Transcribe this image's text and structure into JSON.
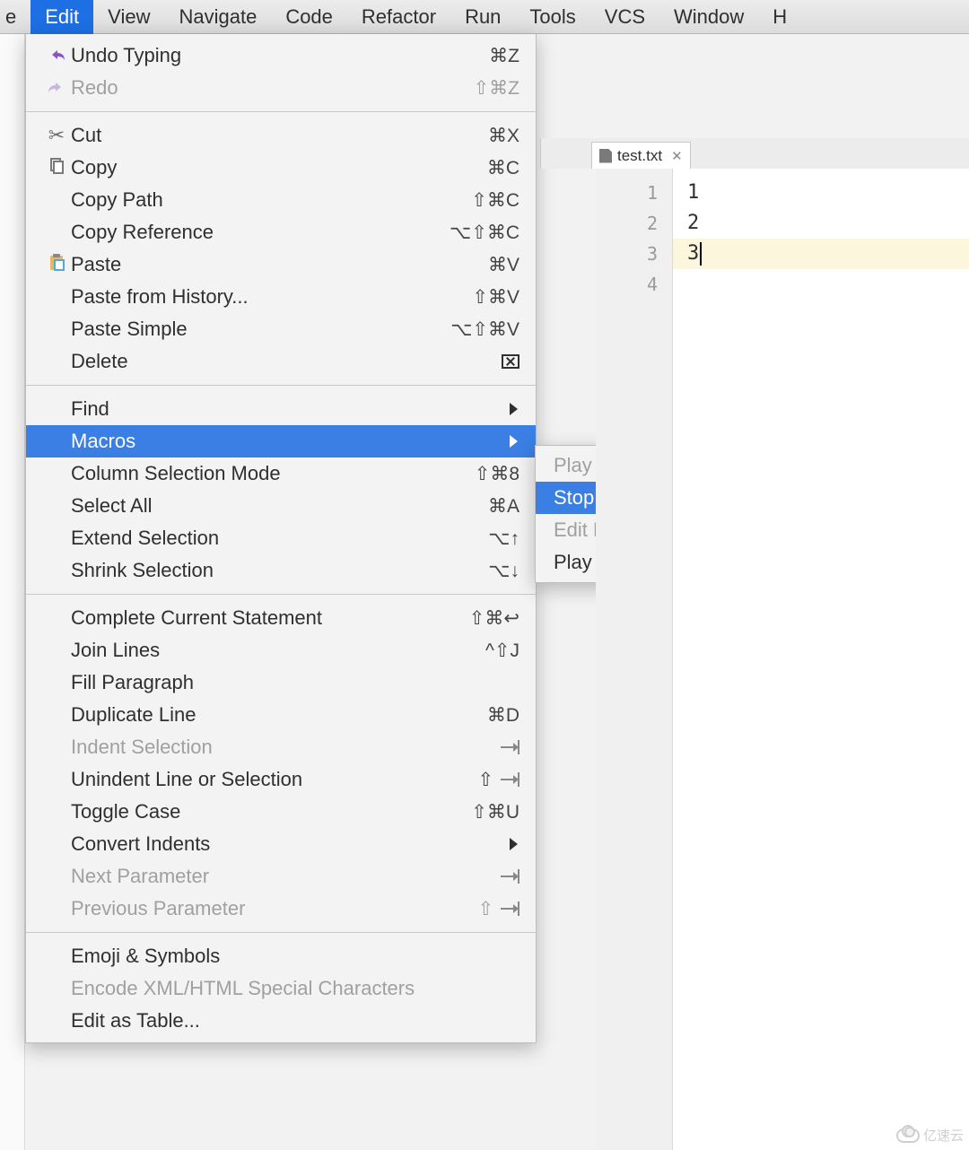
{
  "menubar": {
    "items": [
      "e",
      "Edit",
      "View",
      "Navigate",
      "Code",
      "Refactor",
      "Run",
      "Tools",
      "VCS",
      "Window",
      "H"
    ],
    "selected_index": 1
  },
  "edit_menu": {
    "groups": [
      [
        {
          "icon": "undo",
          "label": "Undo Typing",
          "shortcut": "⌘Z"
        },
        {
          "icon": "redo",
          "label": "Redo",
          "shortcut": "⇧⌘Z",
          "disabled": true
        }
      ],
      [
        {
          "icon": "cut",
          "label": "Cut",
          "shortcut": "⌘X"
        },
        {
          "icon": "copy",
          "label": "Copy",
          "shortcut": "⌘C"
        },
        {
          "label": "Copy Path",
          "shortcut": "⇧⌘C"
        },
        {
          "label": "Copy Reference",
          "shortcut": "⌥⇧⌘C"
        },
        {
          "icon": "paste",
          "label": "Paste",
          "shortcut": "⌘V"
        },
        {
          "label": "Paste from History...",
          "shortcut": "⇧⌘V"
        },
        {
          "label": "Paste Simple",
          "shortcut": "⌥⇧⌘V"
        },
        {
          "label": "Delete",
          "shortcut_icon": "delete"
        }
      ],
      [
        {
          "label": "Find",
          "submenu": true
        },
        {
          "label": "Macros",
          "submenu": true,
          "highlight": true
        },
        {
          "label": "Column Selection Mode",
          "shortcut": "⇧⌘8"
        },
        {
          "label": "Select All",
          "shortcut": "⌘A"
        },
        {
          "label": "Extend Selection",
          "shortcut": "⌥↑"
        },
        {
          "label": "Shrink Selection",
          "shortcut": "⌥↓"
        }
      ],
      [
        {
          "label": "Complete Current Statement",
          "shortcut": "⇧⌘↩"
        },
        {
          "label": "Join Lines",
          "shortcut": "^⇧J"
        },
        {
          "label": "Fill Paragraph"
        },
        {
          "label": "Duplicate Line",
          "shortcut": "⌘D"
        },
        {
          "label": "Indent Selection",
          "shortcut_icon": "indent-right",
          "disabled": true
        },
        {
          "label": "Unindent Line or Selection",
          "shortcut_icon": "indent-left",
          "shortcut": "⇧"
        },
        {
          "label": "Toggle Case",
          "shortcut": "⇧⌘U"
        },
        {
          "label": "Convert Indents",
          "submenu": true
        },
        {
          "label": "Next Parameter",
          "shortcut_icon": "indent-right",
          "disabled": true
        },
        {
          "label": "Previous Parameter",
          "shortcut_icon": "indent-left",
          "shortcut": "⇧",
          "disabled": true
        }
      ],
      [
        {
          "label": "Emoji & Symbols"
        },
        {
          "label": "Encode XML/HTML Special Characters",
          "disabled": true
        },
        {
          "label": "Edit as Table..."
        }
      ]
    ]
  },
  "macros_submenu": [
    {
      "label": "Play Back Last Macro",
      "disabled": true
    },
    {
      "label": "Stop Macro Recording",
      "highlight": true
    },
    {
      "label": "Edit Macros",
      "disabled": true
    },
    {
      "label": "Play Saved Macros..."
    }
  ],
  "editor": {
    "tab": {
      "filename": "test.txt"
    },
    "gutter_lines": [
      "1",
      "2",
      "3",
      "4"
    ],
    "lines": [
      "1",
      "2",
      "3",
      ""
    ],
    "current_line_index": 2
  },
  "watermark": "亿速云"
}
